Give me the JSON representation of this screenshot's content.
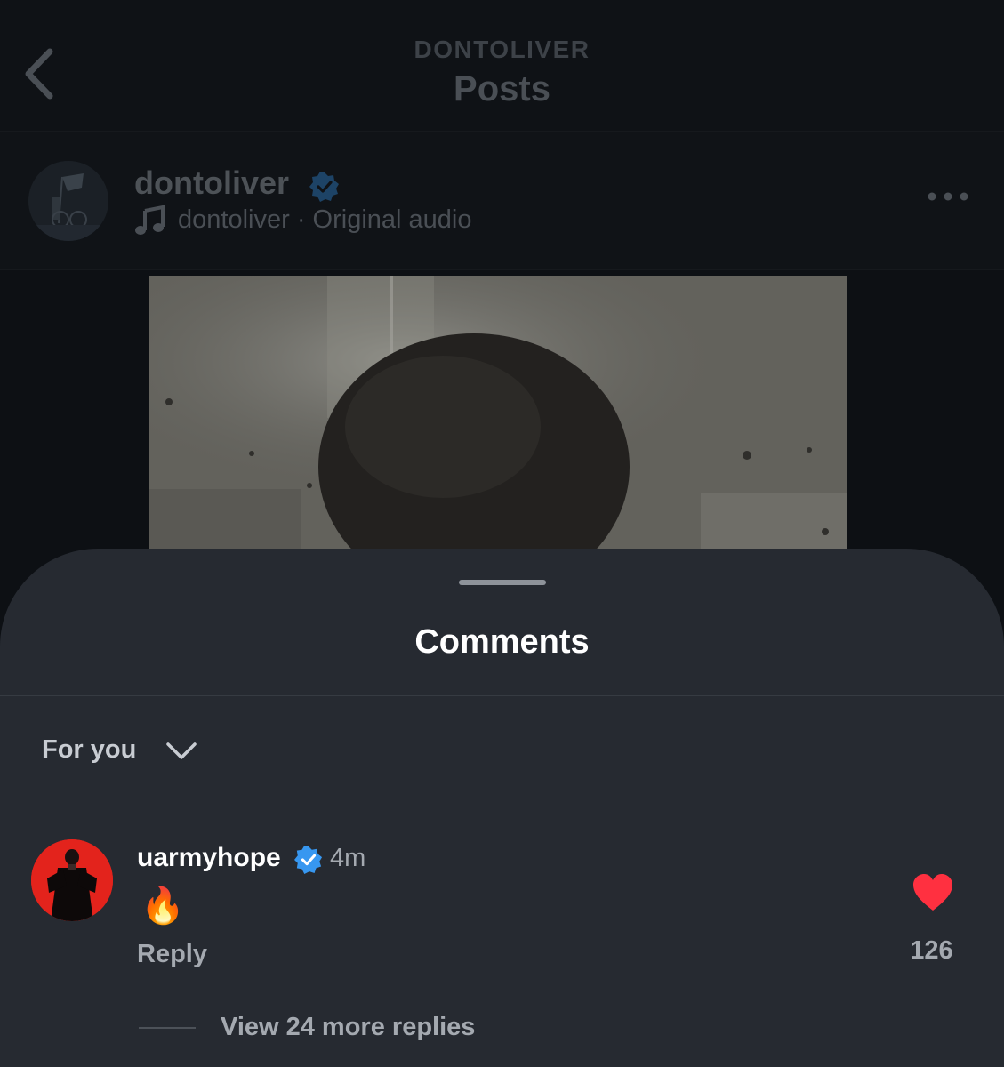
{
  "header": {
    "subtitle": "DONTOLIVER",
    "title": "Posts",
    "back_icon": "chevron-left-icon"
  },
  "post": {
    "username": "dontoliver",
    "verified": true,
    "audio_owner": "dontoliver",
    "audio_separator": "·",
    "audio_label": "Original audio",
    "music_icon": "music-note-icon",
    "more_icon": "more-horizontal-icon"
  },
  "comments_sheet": {
    "title": "Comments",
    "sort_label": "For you",
    "sort_icon": "chevron-down-icon",
    "comments": [
      {
        "username": "uarmyhope",
        "verified": true,
        "time": "4m",
        "text": "🔥",
        "reply_label": "Reply",
        "likes": "126",
        "liked": true,
        "view_replies": "View 24 more replies"
      }
    ]
  },
  "colors": {
    "verified_blue": "#3797f0",
    "heart_red": "#ff3040",
    "sheet_bg": "#262a31"
  }
}
